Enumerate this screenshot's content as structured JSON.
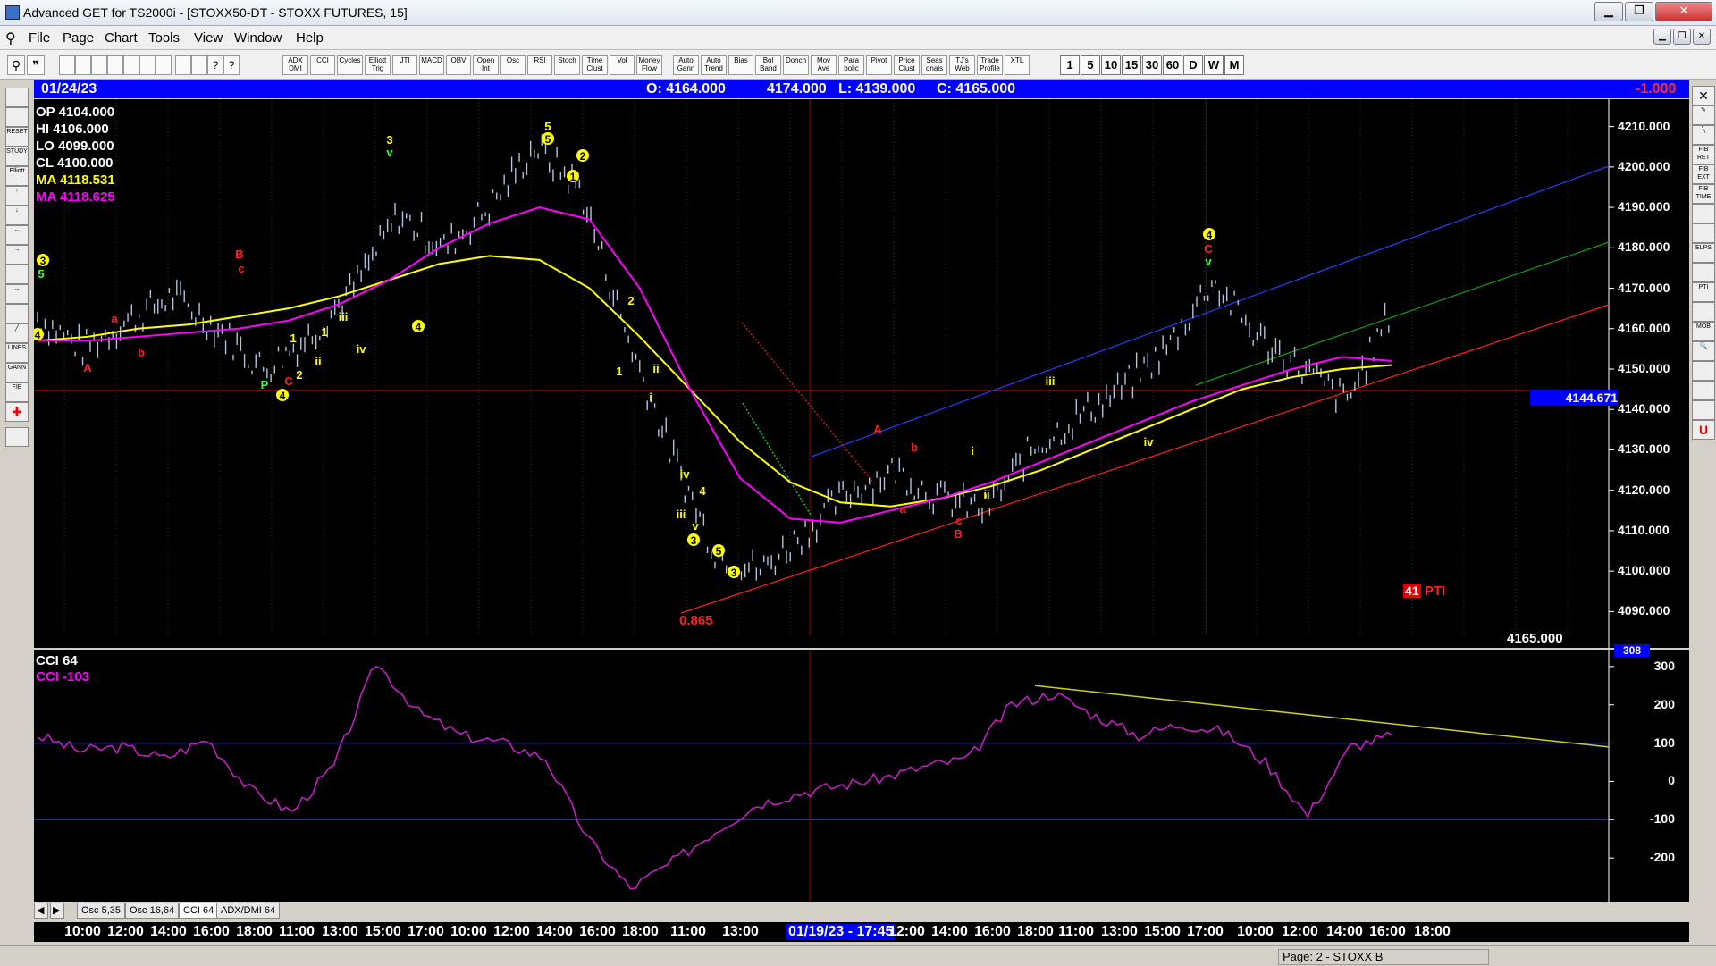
{
  "window": {
    "title": "Advanced GET for TS2000i - [STOXX50-DT - STOXX FUTURES, 15]",
    "buttons": [
      "▁",
      "❐",
      "✕"
    ]
  },
  "menu": [
    "File",
    "Page",
    "Chart",
    "Tools",
    "View",
    "Window",
    "Help"
  ],
  "toolbar": {
    "studies": [
      "ADX DMI",
      "CCI",
      "Cycles",
      "Elliott Trig",
      "JTI",
      "MACD",
      "OBV",
      "Open Int",
      "Osc",
      "RSI",
      "Stoch",
      "Time Clust",
      "Vol",
      "Money Flow",
      "Auto Gann",
      "Auto Trend",
      "Bias",
      "Bol Band",
      "Donch",
      "Mov Ave",
      "Para bolic",
      "Pivot",
      "Price Clust",
      "Seas onals",
      "TJ's Web",
      "Trade Profile",
      "XTL"
    ],
    "intervals": [
      "1",
      "5",
      "10",
      "15",
      "30",
      "60",
      "D",
      "W",
      "M"
    ]
  },
  "header": {
    "date": "01/24/23",
    "open": "O: 4164.000",
    "high": "4174.000",
    "low": "L: 4139.000",
    "close": "C: 4165.000",
    "change": "-1.000"
  },
  "readout": {
    "op": "OP  4104.000",
    "hi": "HI   4106.000",
    "lo": "LO  4099.000",
    "cl": "CL  4100.000",
    "ma1": "MA  4118.531",
    "ma2": "MA  4118.625"
  },
  "price_axis": {
    "labels": [
      "4210.000",
      "4200.000",
      "4190.000",
      "4180.000",
      "4170.000",
      "4160.000",
      "4150.000",
      "4140.000",
      "4130.000",
      "4120.000",
      "4110.000",
      "4100.000",
      "4090.000"
    ],
    "current_label": "4144.671",
    "last_price": "4165.000"
  },
  "cci": {
    "title": "CCI 64",
    "value_label": "CCI  -103",
    "axis_labels": [
      "300",
      "200",
      "100",
      "0",
      "-100",
      "-200"
    ],
    "top_label": "308"
  },
  "pti": {
    "value": "41",
    "label": "PTI"
  },
  "fib_label": "0.865",
  "tabs": [
    "Osc 5,35",
    "Osc 16,64",
    "CCI 64",
    "ADX/DMI 64"
  ],
  "time_axis": [
    "10:00",
    "12:00",
    "14:00",
    "16:00",
    "18:00",
    "11:00",
    "13:00",
    "15:00",
    "17:00",
    "10:00",
    "12:00",
    "14:00",
    "16:00",
    "18:00",
    "11:00",
    "13:00",
    "01/19/23 - 17:45",
    "12:00",
    "14:00",
    "16:00",
    "18:00",
    "11:00",
    "13:00",
    "15:00",
    "17:00",
    "10:00",
    "12:00",
    "14:00",
    "16:00",
    "18:00"
  ],
  "status": "Page: 2 - STOXX B",
  "colors": {
    "wave_yellow": "#ffff00",
    "wave_red": "#ff0000",
    "ma_yellow": "#ffff00",
    "ma_magenta": "#ff00ff",
    "cci_line": "#c020c0",
    "bars": "#b0c4de"
  },
  "chart_data": {
    "type": "line",
    "title": "STOXX50-DT - STOXX FUTURES, 15",
    "ylim": [
      4085,
      4215
    ],
    "series": [
      {
        "name": "MA",
        "values": [
          4157,
          4158,
          4160,
          4161,
          4163,
          4165,
          4168,
          4172,
          4176,
          4178,
          4177,
          4170,
          4158,
          4145,
          4132,
          4122,
          4117,
          4116,
          4118,
          4121,
          4125,
          4130,
          4135,
          4140,
          4145,
          4148,
          4150,
          4151
        ]
      },
      {
        "name": "MA",
        "values": [
          4157,
          4157,
          4158,
          4159,
          4160,
          4162,
          4166,
          4172,
          4180,
          4186,
          4190,
          4187,
          4170,
          4145,
          4123,
          4113,
          4112,
          4115,
          4118,
          4122,
          4127,
          4132,
          4137,
          4142,
          4146,
          4150,
          4153,
          4152
        ]
      }
    ],
    "price": [
      4163,
      4155,
      4162,
      4168,
      4160,
      4150,
      4158,
      4170,
      4188,
      4180,
      4190,
      4205,
      4195,
      4160,
      4130,
      4105,
      4100,
      4110,
      4120,
      4125,
      4118,
      4115,
      4130,
      4138,
      4145,
      4155,
      4172,
      4158,
      4150,
      4142,
      4165
    ],
    "cci_values": [
      120,
      80,
      90,
      60,
      110,
      -20,
      -80,
      40,
      310,
      180,
      120,
      100,
      60,
      -150,
      -280,
      -210,
      -130,
      -60,
      -30,
      -10,
      10,
      40,
      60,
      200,
      230,
      170,
      120,
      150,
      130,
      50,
      -90,
      90,
      120
    ],
    "wave_labels": [
      "3",
      "5",
      "4",
      "A",
      "a",
      "b",
      "B",
      "c",
      "C",
      "P",
      "2",
      "4",
      "1",
      "1",
      "ii",
      "iii",
      "iv",
      "3",
      "v",
      "4",
      "5",
      "5",
      "2",
      "1",
      "2",
      "1",
      "ii",
      "i",
      "iv",
      "4",
      "iii",
      "v",
      "3",
      "5",
      "3",
      "A",
      "b",
      "a",
      "c",
      "B",
      "i",
      "ii",
      "iii",
      "iv",
      "4",
      "C",
      "v"
    ]
  }
}
